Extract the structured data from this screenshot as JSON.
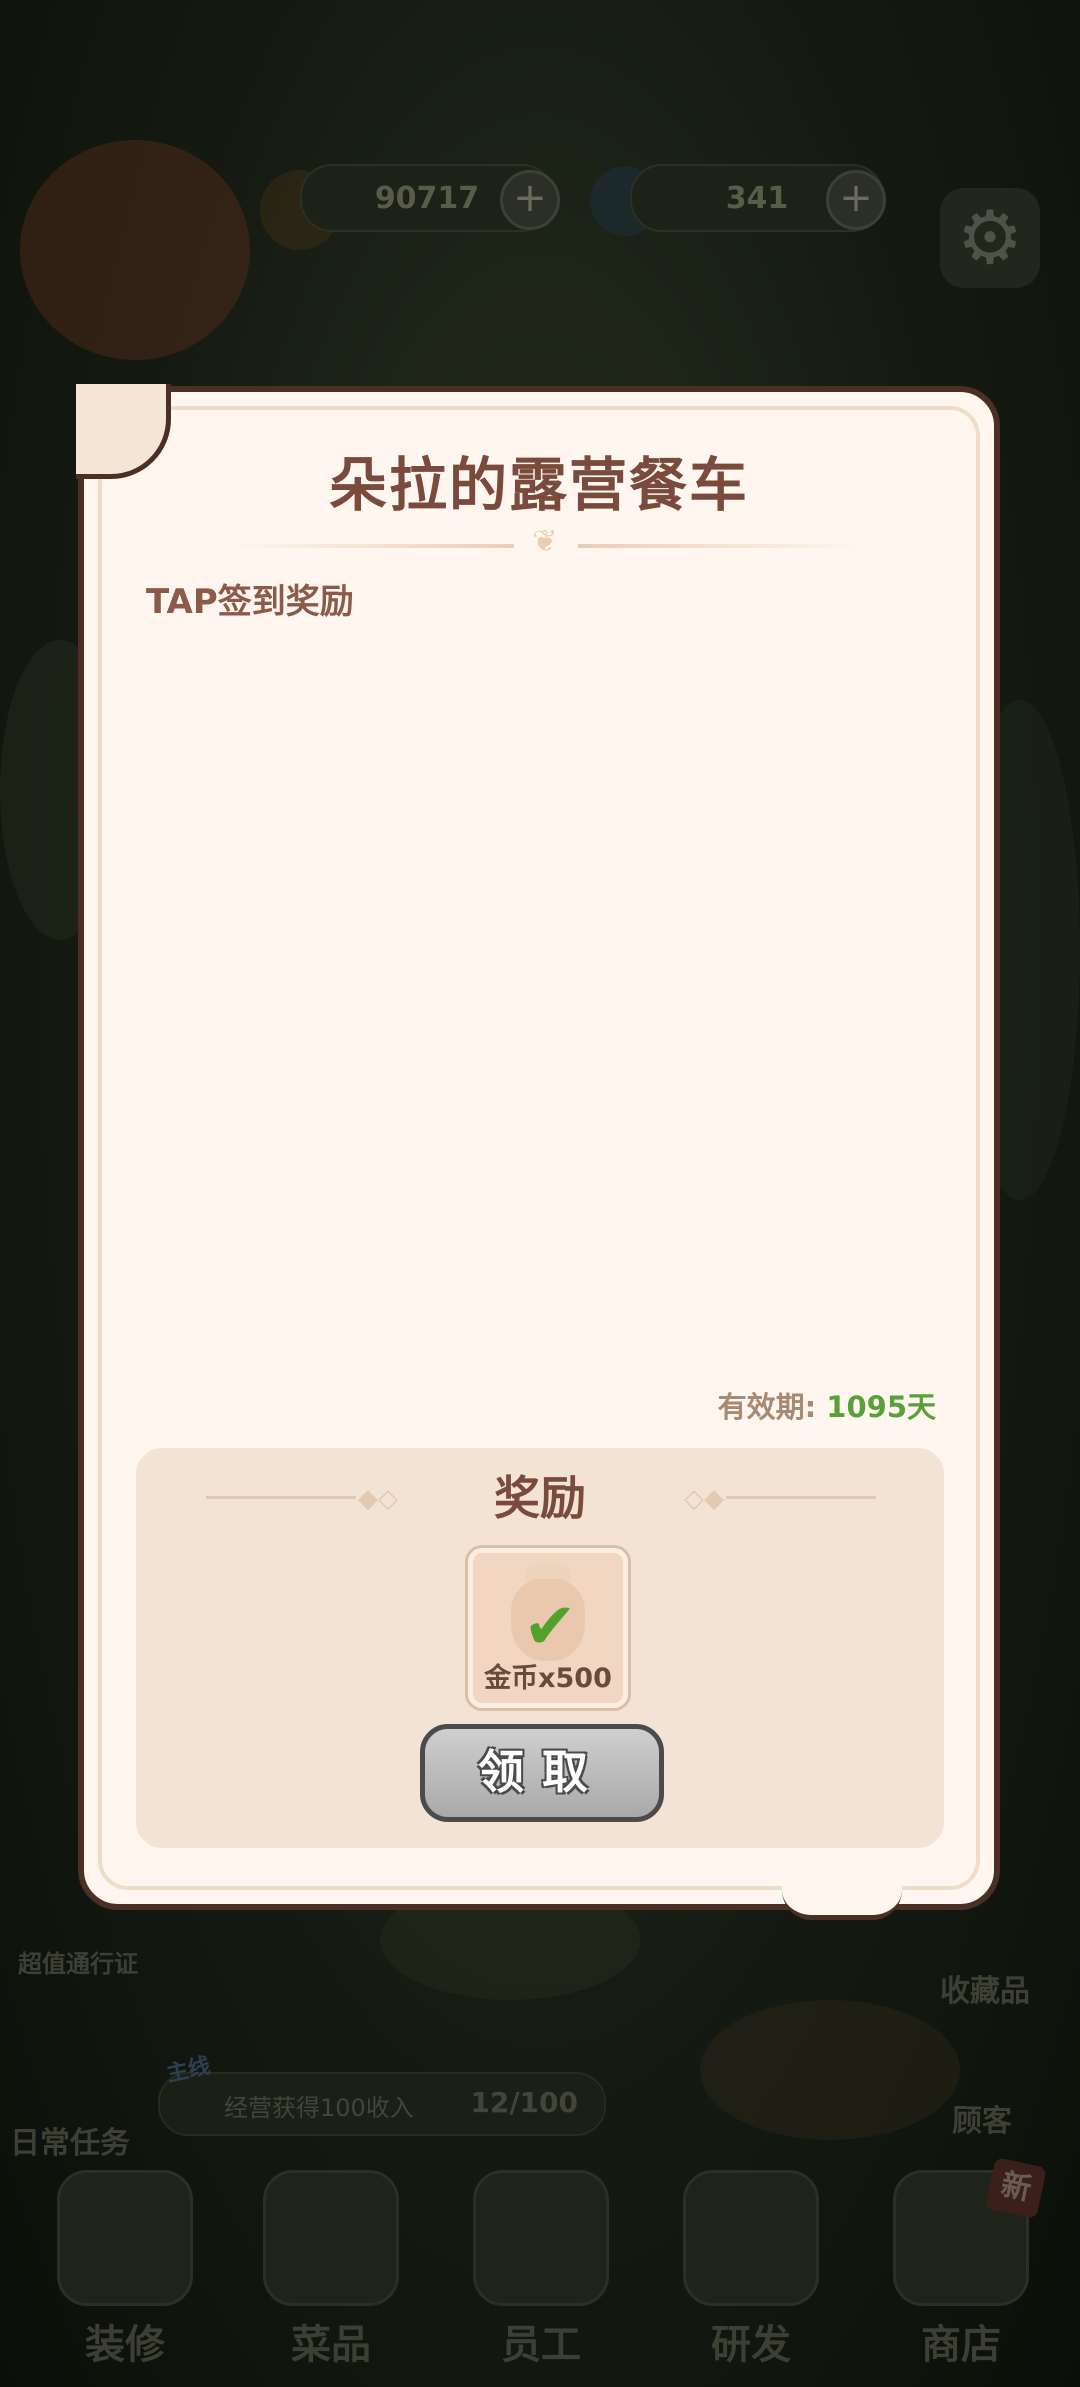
{
  "hud": {
    "coins": "90717",
    "gems": "341"
  },
  "background_labels": {
    "pass": "超值通行证",
    "collection": "收藏品",
    "customers": "顾客",
    "daily_tasks": "日常任务",
    "main_quest_tag": "主线",
    "main_quest_text": "经营获得100收入",
    "main_quest_progress": "12/100",
    "new_badge": "新"
  },
  "bottom_nav": [
    {
      "label": "装修"
    },
    {
      "label": "菜品"
    },
    {
      "label": "员工"
    },
    {
      "label": "研发"
    },
    {
      "label": "商店"
    }
  ],
  "dialog": {
    "title": "朵拉的露营餐车",
    "subtitle": "TAP签到奖励",
    "validity_label": "有效期:",
    "validity_value": "1095天",
    "reward_title": "奖励",
    "reward_item": "金币x500",
    "claim_label": "领取"
  },
  "colors": {
    "title": "#7a4b3c",
    "validity_value": "#5aa03a",
    "dialog_bg": "#fff7ef",
    "check": "#52a12a"
  }
}
